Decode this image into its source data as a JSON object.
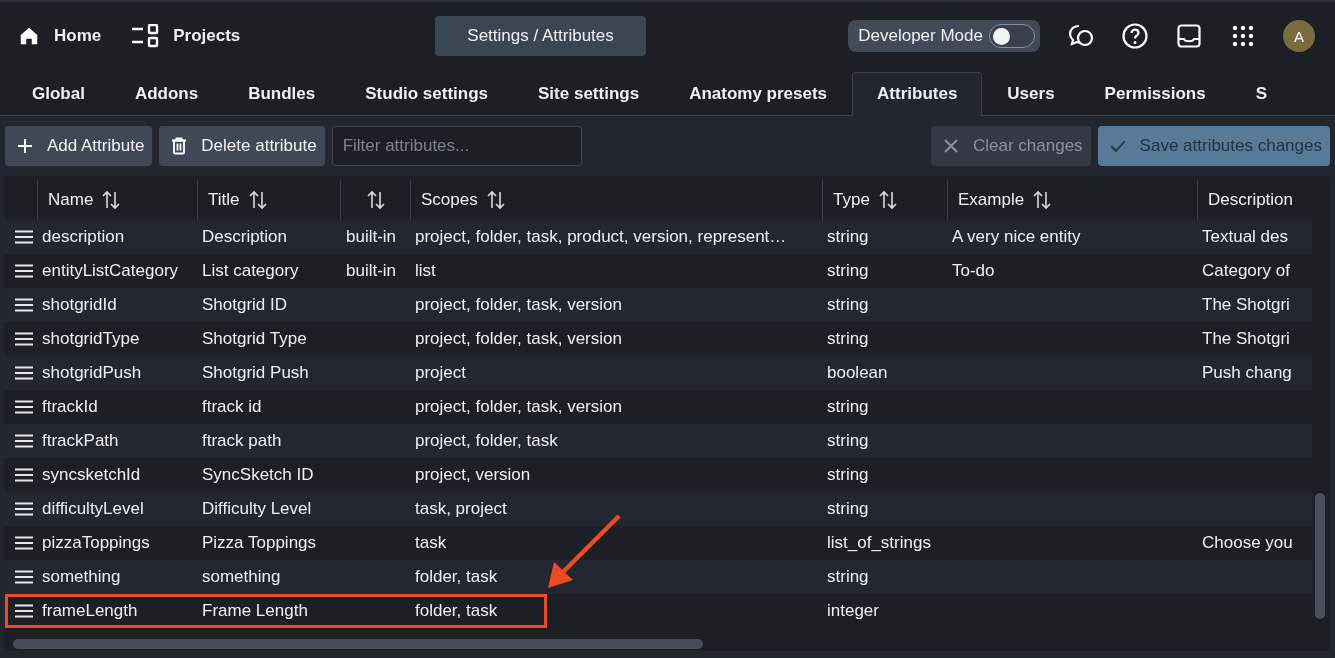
{
  "nav": {
    "home": "Home",
    "projects": "Projects",
    "breadcrumb": "Settings / Attributes",
    "developer_mode": {
      "label": "Developer Mode",
      "on": false
    },
    "avatar": "A"
  },
  "tabs": [
    {
      "label": "Global",
      "selected": false
    },
    {
      "label": "Addons",
      "selected": false
    },
    {
      "label": "Bundles",
      "selected": false
    },
    {
      "label": "Studio settings",
      "selected": false
    },
    {
      "label": "Site settings",
      "selected": false
    },
    {
      "label": "Anatomy presets",
      "selected": false
    },
    {
      "label": "Attributes",
      "selected": true
    },
    {
      "label": "Users",
      "selected": false
    },
    {
      "label": "Permissions",
      "selected": false
    },
    {
      "label": "S",
      "selected": false
    }
  ],
  "toolbar": {
    "add": "Add Attribute",
    "delete": "Delete attribute",
    "filter": {
      "placeholder": "Filter attributes..."
    },
    "clear": {
      "label": "Clear changes",
      "disabled": true
    },
    "save": {
      "label": "Save attributes changes",
      "disabled": true
    }
  },
  "table": {
    "columns": [
      {
        "label": "Name",
        "sortable": true
      },
      {
        "label": "Title",
        "sortable": true
      },
      {
        "sortable": true
      },
      {
        "label": "Scopes",
        "sortable": true
      },
      {
        "label": "Type",
        "sortable": true
      },
      {
        "label": "Example",
        "sortable": true
      },
      {
        "label": "Description"
      }
    ],
    "rows": [
      {
        "name": "description",
        "title": "Description",
        "column_3": "built-in",
        "scopes": "project, folder, task, product, version, represent…",
        "type": "string",
        "example": "A very nice entity",
        "description": "Textual des",
        "highlighted": false
      },
      {
        "name": "entityListCategory",
        "title": "List category",
        "column_3": "built-in",
        "scopes": "list",
        "type": "string",
        "example": "To-do",
        "description": "Category of",
        "highlighted": false
      },
      {
        "name": "shotgridId",
        "title": "Shotgrid ID",
        "scopes": "project, folder, task, version",
        "type": "string",
        "description": "The Shotgri",
        "highlighted": false
      },
      {
        "name": "shotgridType",
        "title": "Shotgrid Type",
        "scopes": "project, folder, task, version",
        "type": "string",
        "description": "The Shotgri",
        "highlighted": false
      },
      {
        "name": "shotgridPush",
        "title": "Shotgrid Push",
        "scopes": "project",
        "type": "boolean",
        "description": "Push chang",
        "highlighted": false
      },
      {
        "name": "ftrackId",
        "title": "ftrack id",
        "scopes": "project, folder, task, version",
        "type": "string",
        "highlighted": false
      },
      {
        "name": "ftrackPath",
        "title": "ftrack path",
        "scopes": "project, folder, task",
        "type": "string",
        "highlighted": false
      },
      {
        "name": "syncsketchId",
        "title": "SyncSketch ID",
        "scopes": "project, version",
        "type": "string",
        "highlighted": false
      },
      {
        "name": "difficultyLevel",
        "title": "Difficulty Level",
        "scopes": "task, project",
        "type": "string",
        "highlighted": false
      },
      {
        "name": "pizzaToppings",
        "title": "Pizza Toppings",
        "scopes": "task",
        "type": "list_of_strings",
        "description": "Choose you",
        "highlighted": false
      },
      {
        "name": "something",
        "title": "something",
        "scopes": "folder, task",
        "type": "string",
        "highlighted": false
      },
      {
        "name": "frameLength",
        "title": "Frame Length",
        "scopes": "folder, task",
        "type": "integer",
        "highlighted": true
      }
    ]
  }
}
